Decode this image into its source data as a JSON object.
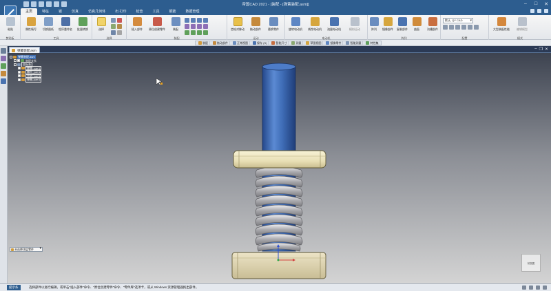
{
  "app": {
    "title": "帝国CAD 2021 - [装配 - [弹簧装配.asm]]"
  },
  "ribbon_tabs": [
    "主页",
    "特征",
    "钣",
    "仿真",
    "仿真几何体",
    "出 打印",
    "检查",
    "工具",
    "钢筋",
    "数据管理"
  ],
  "ribbon": {
    "groups": [
      {
        "title": "剪贴板",
        "buttons": [
          {
            "label": "粘贴"
          }
        ]
      },
      {
        "title": "工具",
        "buttons": [
          {
            "label": "属性填写"
          },
          {
            "label": "切换图纸"
          },
          {
            "label": "程序重命名"
          },
          {
            "label": "批量转换"
          }
        ]
      },
      {
        "title": "选择",
        "buttons": [
          {
            "label": "选择"
          }
        ]
      },
      {
        "title": "装配",
        "buttons": [
          {
            "label": "插入部件"
          },
          {
            "label": "原位创建零件"
          },
          {
            "label": "装配"
          }
        ]
      },
      {
        "title": "运动",
        "buttons": [
          {
            "label": "齿轮对移动"
          },
          {
            "label": "拖动部件"
          },
          {
            "label": "替换零件"
          }
        ]
      },
      {
        "title": "电动机",
        "buttons": [
          {
            "label": "旋转电动机"
          },
          {
            "label": "线性电动机"
          },
          {
            "label": "流量电动机"
          },
          {
            "label": "模拟运动"
          }
        ]
      },
      {
        "title": "阵列",
        "buttons": [
          {
            "label": "阵列"
          },
          {
            "label": "镜像部件"
          },
          {
            "label": "复制部件"
          },
          {
            "label": "曲面"
          },
          {
            "label": "沟槽部件"
          }
        ]
      },
      {
        "title": "配置",
        "dropdown": "默认, QY CAD"
      },
      {
        "title": "模式",
        "buttons": [
          {
            "label": "大型装配性能"
          },
          {
            "label": "编辑模型"
          }
        ]
      }
    ]
  },
  "context_toolbar": [
    "装配",
    "拖动部件",
    "正常视图",
    "保存 (S)",
    "智能尺寸",
    "测量",
    "草图视图",
    "镜像零件",
    "智能测量",
    "特性集"
  ],
  "document": {
    "tab_label": "弹簧装配.asm"
  },
  "tree": [
    {
      "label": "弹簧装配.asm",
      "level": 0,
      "selected": true
    },
    {
      "label": "装配关系",
      "level": 1
    },
    {
      "label": "坐标系",
      "level": 1,
      "box": true
    },
    {
      "label": "底座_par:1",
      "level": 2
    },
    {
      "label": "螺杆_par:1",
      "level": 2
    },
    {
      "label": "手柄_par:1",
      "level": 2
    },
    {
      "label": "弹簧_par:1",
      "level": 2
    }
  ],
  "viewport": {
    "combo_label": "未选择顶层零件",
    "navcube_label": "前视图"
  },
  "statusbar": {
    "label": "提示条",
    "message": "选择部件以进行编辑。或单击\"插入部件\"命令、\"原位创建零件\"命令、\"零件库\"选项卡，或从 Windows 资源管理器拖出部件。"
  },
  "colors": {
    "accent": "#2d5d8f",
    "rod": "#3f6db7",
    "spring": "#c8c8cc",
    "handle": "#efe8c2",
    "base": "#dcd3b1"
  }
}
